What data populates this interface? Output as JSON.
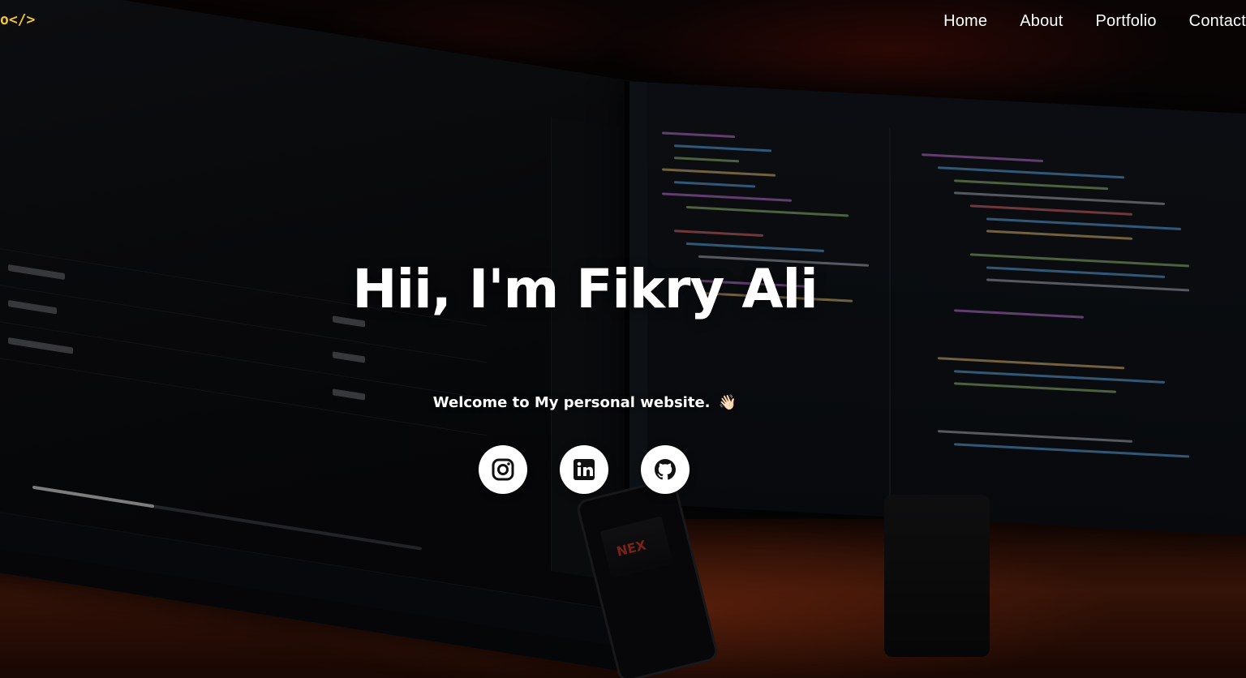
{
  "logo": {
    "text": "o</>"
  },
  "nav": {
    "items": [
      {
        "label": "Home"
      },
      {
        "label": "About"
      },
      {
        "label": "Portfolio"
      },
      {
        "label": "Contact"
      }
    ]
  },
  "hero": {
    "title": "Hii, I'm Fikry Ali",
    "subtitle": "Welcome to My personal website.",
    "subtitle_emoji": "👋🏻"
  },
  "socials": [
    {
      "name": "instagram",
      "icon": "instagram-icon"
    },
    {
      "name": "linkedin",
      "icon": "linkedin-icon"
    },
    {
      "name": "github",
      "icon": "github-icon"
    }
  ],
  "colors": {
    "accent": "#f4c430",
    "text": "#ffffff",
    "icon": "#111111"
  }
}
